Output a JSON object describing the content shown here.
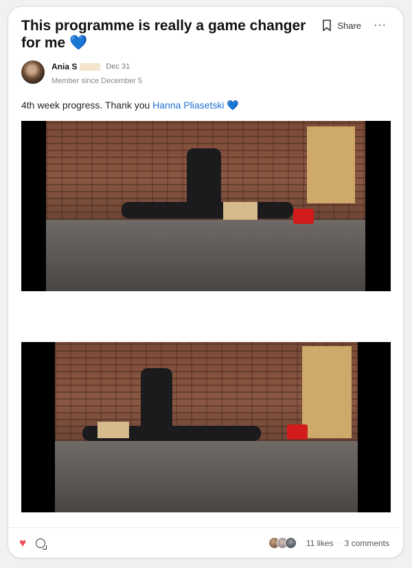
{
  "post": {
    "title": "This programme is really a game changer for me",
    "title_emoji": "💙",
    "author_name": "Ania S",
    "date": "Dec 31",
    "member_since": "Member since December 5",
    "body_prefix": "4th week progress. Thank you ",
    "mention": "Hanna Pliasetski",
    "body_emoji": "💙"
  },
  "actions": {
    "share_label": "Share",
    "more_label": "···"
  },
  "footer": {
    "likes": "11 likes",
    "separator": "·",
    "comments": "3 comments"
  },
  "icons": [
    "bookmark-icon",
    "more-icon",
    "heart-icon",
    "comment-icon"
  ],
  "colors": {
    "mention": "#1f6fd1",
    "like_heart": "#ef4d5a",
    "emoji_heart": "#1e88e5"
  }
}
